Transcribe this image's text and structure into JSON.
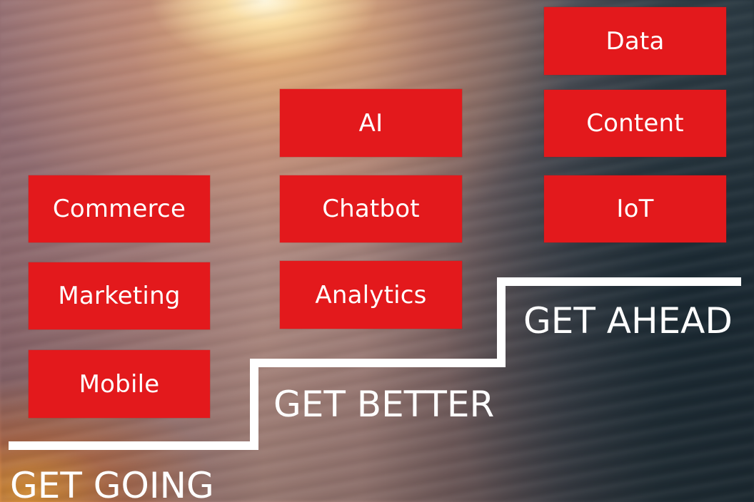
{
  "tiers": {
    "going": {
      "label": "GET GOING",
      "items": [
        "Commerce",
        "Marketing",
        "Mobile"
      ]
    },
    "better": {
      "label": "GET BETTER",
      "items": [
        "AI",
        "Chatbot",
        "Analytics"
      ]
    },
    "ahead": {
      "label": "GET AHEAD",
      "items": [
        "Data",
        "Content",
        "IoT"
      ]
    }
  },
  "colors": {
    "box": "#e3191c",
    "line": "#ffffff",
    "text": "#ffffff"
  }
}
